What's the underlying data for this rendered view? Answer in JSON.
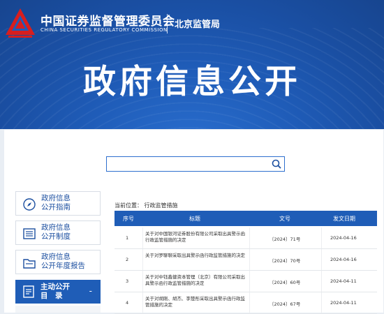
{
  "header": {
    "org_name_cn": "中国证券监督管理委员会",
    "org_name_en": "CHINA SECURITIES REGULATORY COMMISSION",
    "bureau": "北京监管局",
    "page_title": "政府信息公开"
  },
  "search": {
    "placeholder": "",
    "value": ""
  },
  "sidebar": {
    "items": [
      {
        "line1": "政府信息",
        "line2": "公开指南",
        "icon": "compass-icon"
      },
      {
        "line1": "政府信息",
        "line2": "公开制度",
        "icon": "list-icon"
      },
      {
        "line1": "政府信息",
        "line2": "公开年度报告",
        "icon": "folder-icon"
      }
    ],
    "active": {
      "line1": "主动公开",
      "line2": "目　录",
      "toggle": "-",
      "icon": "document-icon"
    }
  },
  "breadcrumb": "当前位置：  行政监管措施",
  "table": {
    "headers": {
      "no": "序号",
      "title": "标题",
      "doc": "文号",
      "date": "发文日期"
    },
    "rows": [
      {
        "no": "1",
        "title": "关于对中国银河证券股份有限公司采取出具警示函行政监管措施的决定",
        "doc": "〔2024〕71号",
        "date": "2024-04-16"
      },
      {
        "no": "2",
        "title": "关于对罗聊聊采取出具警示函行政监管措施的决定",
        "doc": "〔2024〕70号",
        "date": "2024-04-16"
      },
      {
        "no": "3",
        "title": "关于对中钰鑫健资本管理（北京）有限公司采取出具警示函行政监管措施的决定",
        "doc": "〔2024〕60号",
        "date": "2024-04-11"
      },
      {
        "no": "4",
        "title": "关于对胡刚、胡杰、李楚彤采取出具警示函行政监管措施的决定",
        "doc": "〔2024〕67号",
        "date": "2024-04-11"
      }
    ]
  },
  "colors": {
    "header_blue": "#1f5cb8",
    "logo_red": "#d81e1e",
    "accent_blue": "#1f5db7"
  }
}
